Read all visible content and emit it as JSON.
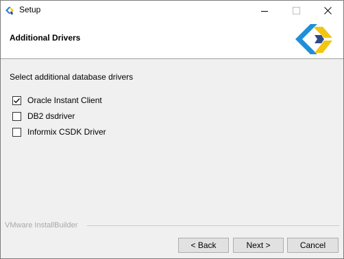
{
  "window": {
    "title": "Setup"
  },
  "header": {
    "title": "Additional Drivers",
    "logo_icon": "installbuilder-logo-icon"
  },
  "body": {
    "prompt": "Select additional database drivers",
    "drivers": [
      {
        "label": "Oracle Instant Client",
        "checked": true
      },
      {
        "label": "DB2 dsdriver",
        "checked": false
      },
      {
        "label": "Informix CSDK Driver",
        "checked": false
      }
    ]
  },
  "footer": {
    "brand": "VMware InstallBuilder",
    "back_label": "< Back",
    "next_label": "Next >",
    "cancel_label": "Cancel"
  },
  "colors": {
    "logo_blue": "#1e8fd8",
    "logo_yellow": "#f2c511",
    "logo_darkblue": "#2f4a8a"
  }
}
